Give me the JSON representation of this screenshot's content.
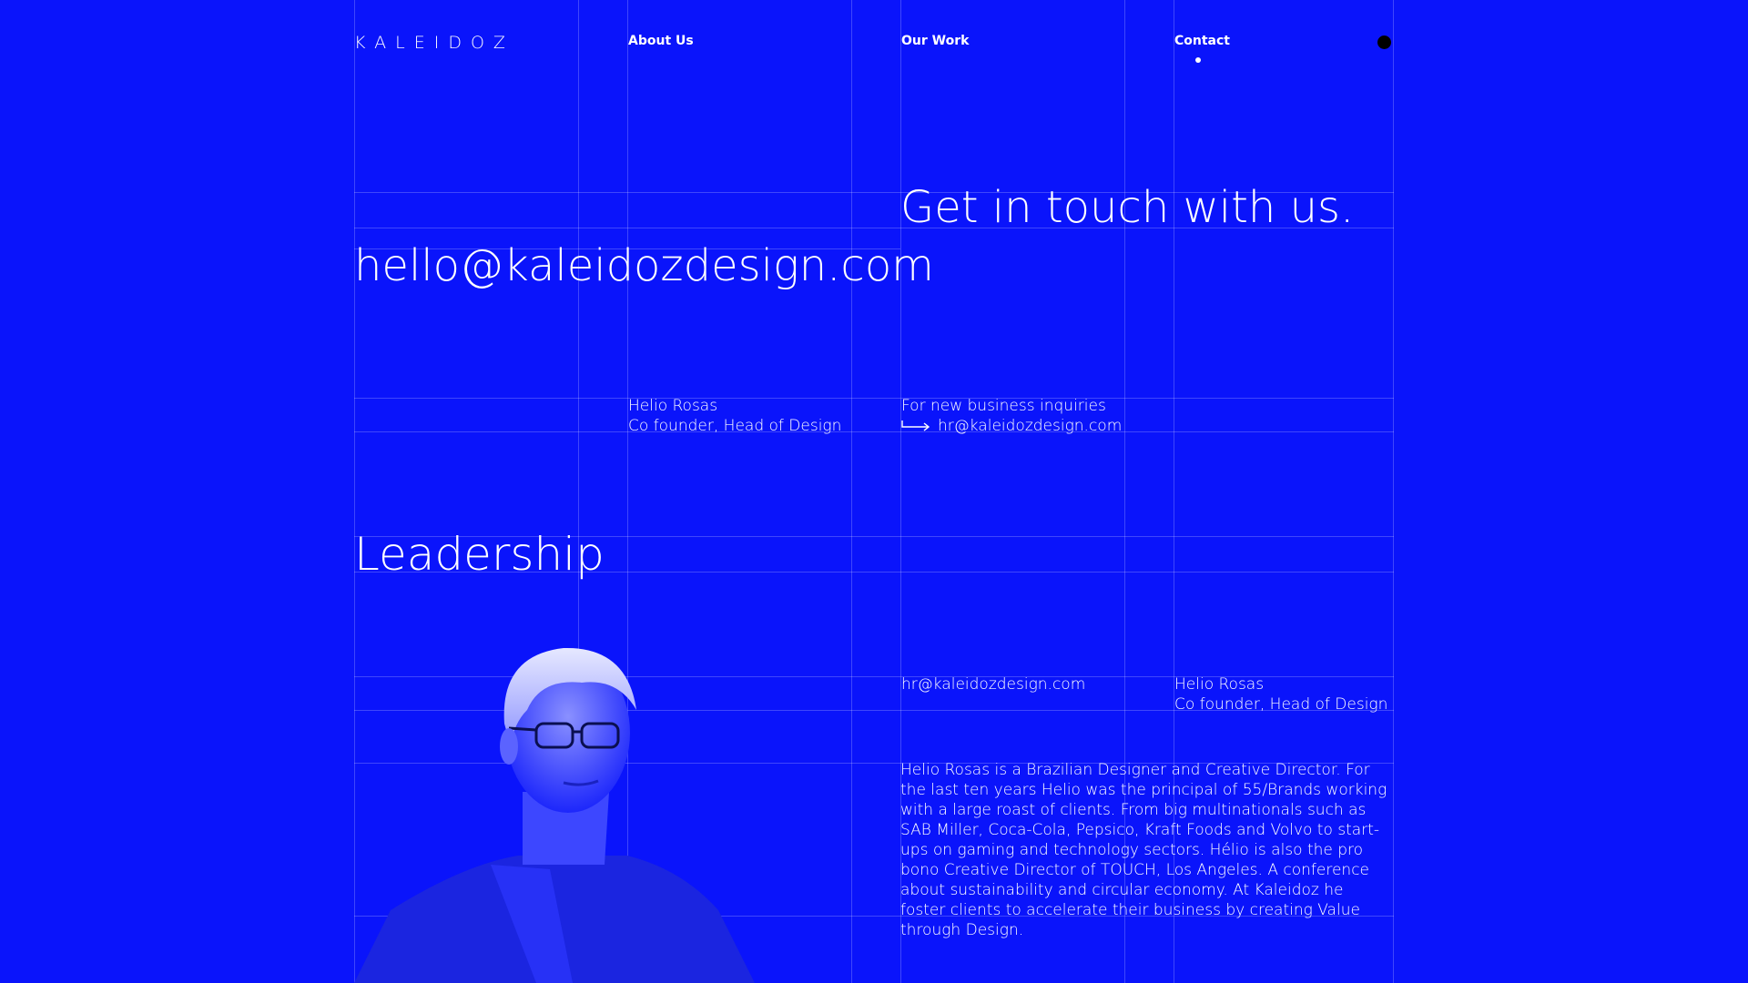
{
  "colors": {
    "background": "#0a14fb",
    "text": "#ffffff",
    "menu_dot": "#000000"
  },
  "nav": {
    "logo": "KALEIDOZ",
    "links": [
      "About Us",
      "Our Work",
      "Contact"
    ],
    "active": "Contact",
    "menu_icon": "black-dot-menu-icon"
  },
  "contact": {
    "heading": "Get in touch with us.",
    "main_email": "hello@kaleidozdesign.com",
    "person": {
      "name": "Helio Rosas",
      "role": "Co founder, Head of Design"
    },
    "inquiries": {
      "label": "For new business inquiries",
      "email": "hr@kaleidozdesign.com",
      "arrow_icon": "arrow-right-icon"
    }
  },
  "leadership": {
    "heading": "Leadership",
    "email": "hr@kaleidozdesign.com",
    "name": "Helio Rosas",
    "role": "Co founder, Head of Design",
    "bio": "Helio Rosas is a Brazilian Designer and Creative Director. For the last ten years Helio was the principal of 55/Brands working with a large roast of clients. From big multinationals such as SAB Miller, Coca-Cola, Pepsico, Kraft Foods and Volvo to start-ups on gaming and technology sectors. Hélio is also the pro bono Creative Director of TOUCH, Los Angeles. A conference about sustainability and circular economy. At Kaleidoz he foster clients to accelerate their business by creating Value through Design."
  }
}
